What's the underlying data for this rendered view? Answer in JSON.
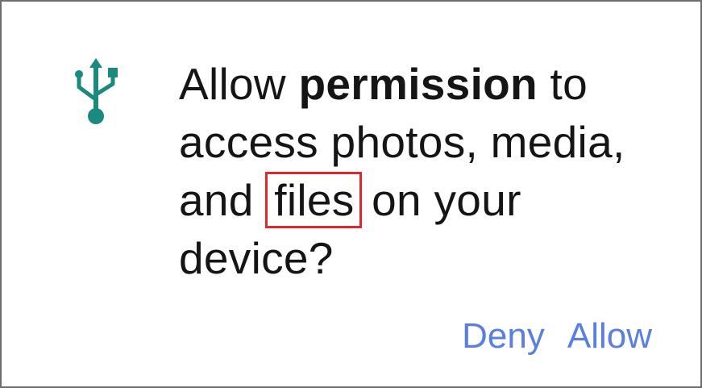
{
  "dialog": {
    "icon": "usb-icon",
    "icon_color": "#1a8a7e",
    "message": {
      "prefix": "Allow ",
      "bold": "permission",
      "middle": " to access photos, media, and ",
      "highlighted": "files",
      "suffix": " on your device?"
    },
    "highlight_color": "#e0282e",
    "buttons": {
      "deny": "Deny",
      "allow": "Allow"
    },
    "button_color": "#5a7fe0"
  }
}
